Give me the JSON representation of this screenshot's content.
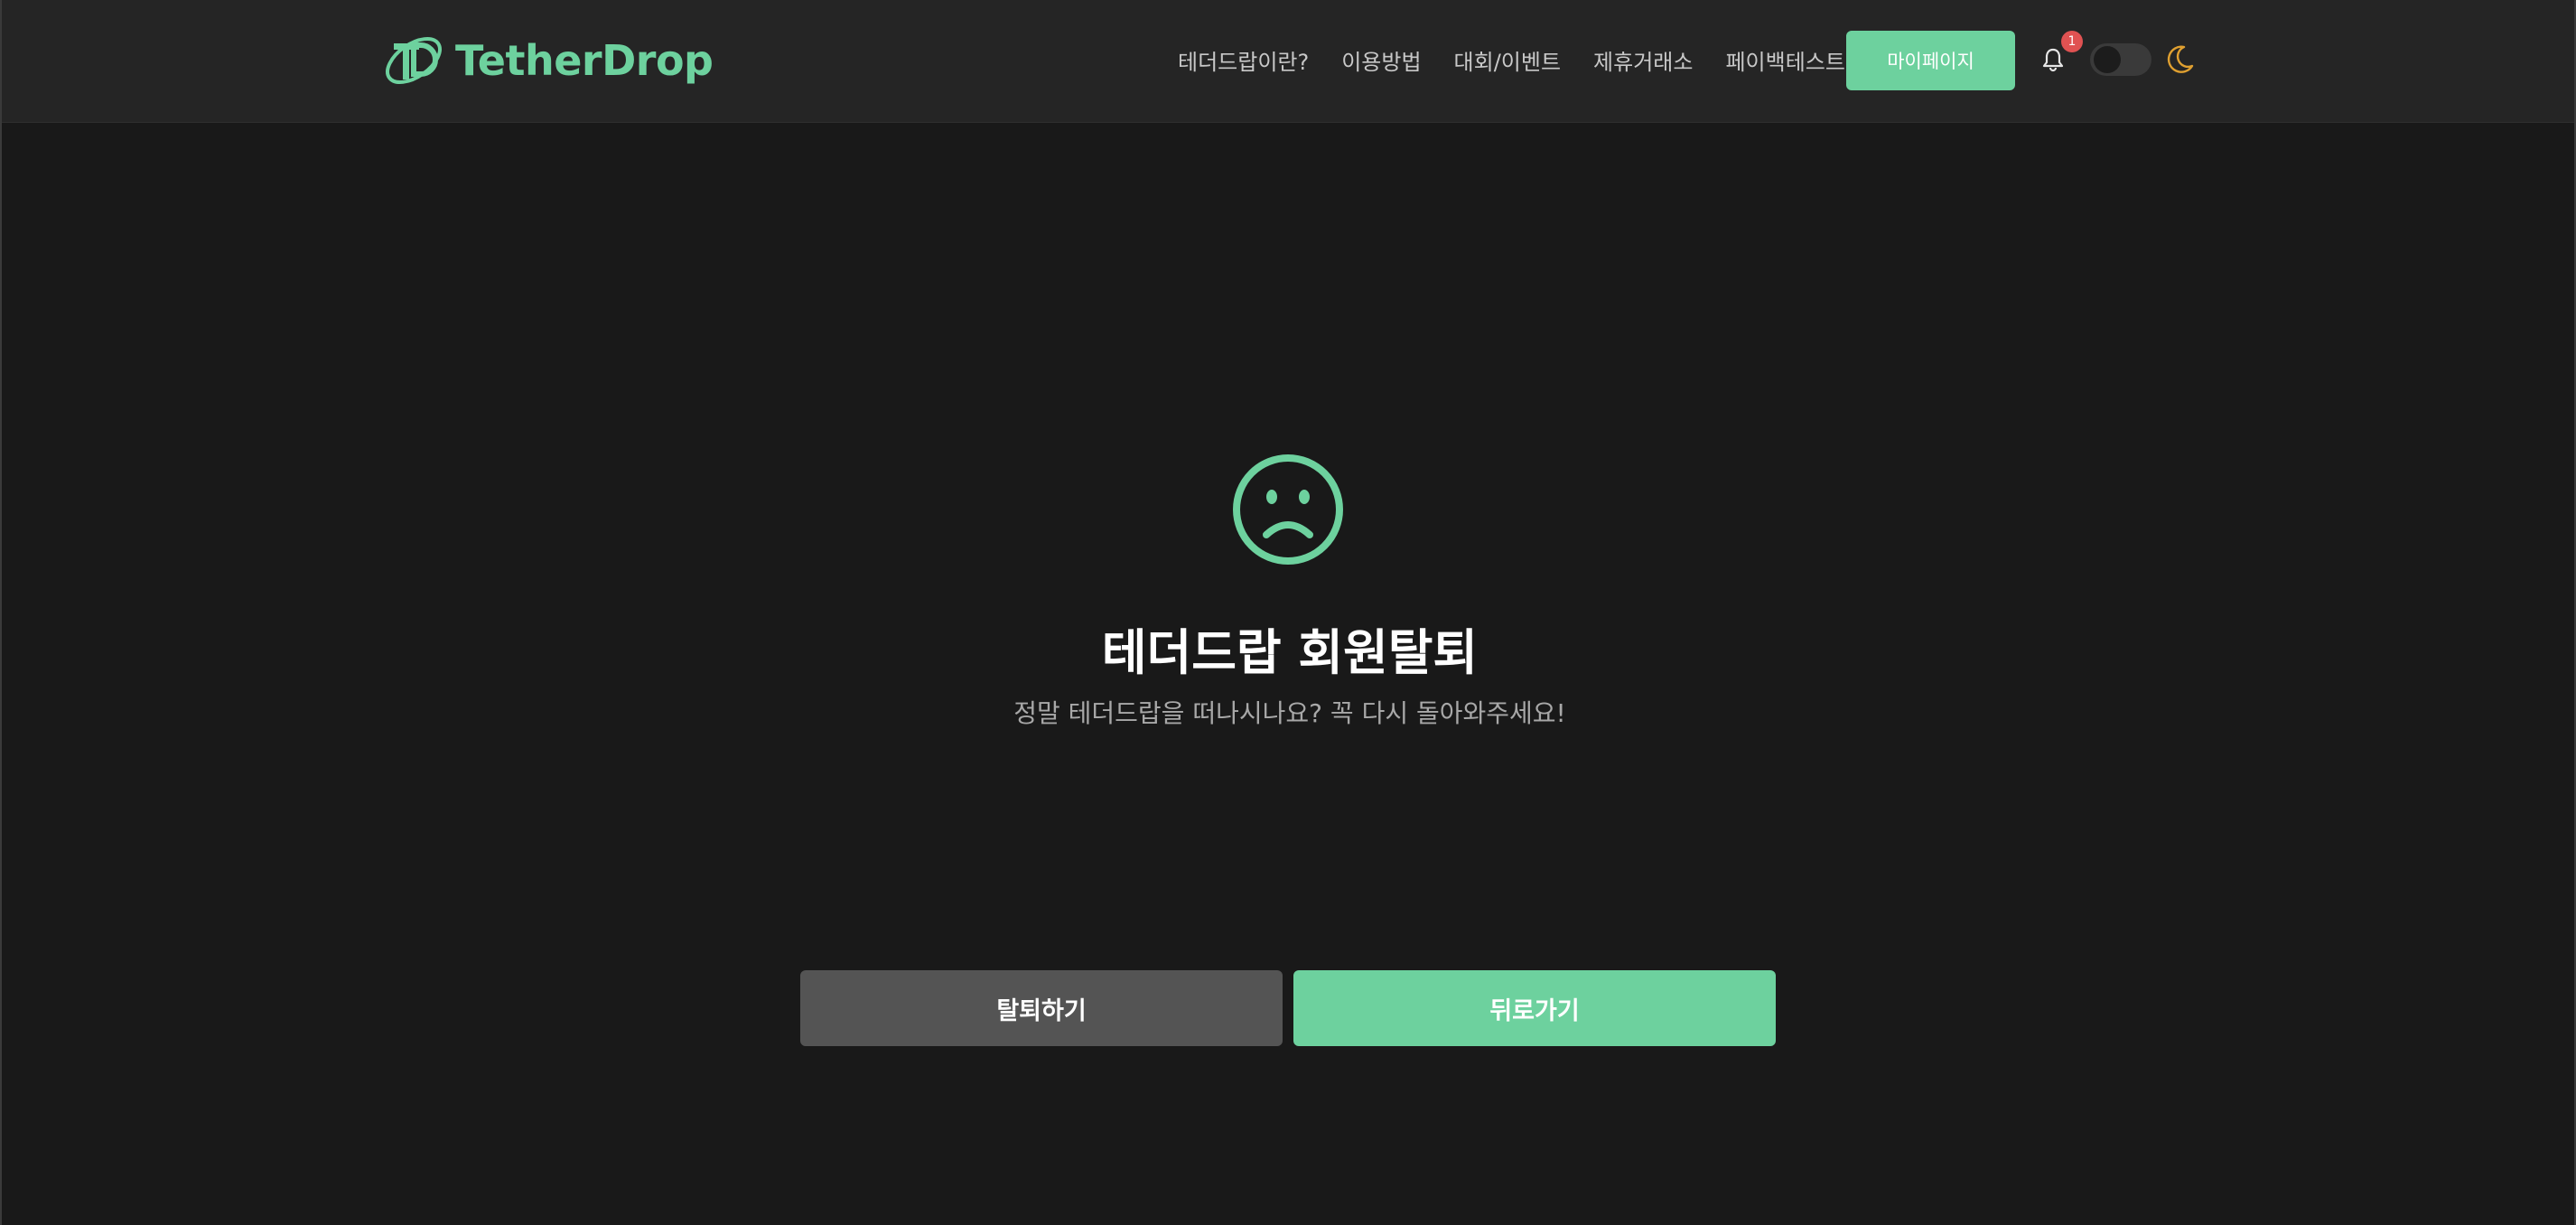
{
  "brand": {
    "name": "TetherDrop",
    "accent": "#6dd19e"
  },
  "nav": {
    "items": [
      {
        "label": "테더드랍이란?"
      },
      {
        "label": "이용방법"
      },
      {
        "label": "대회/이벤트"
      },
      {
        "label": "제휴거래소"
      },
      {
        "label": "페이백테스트"
      }
    ],
    "mypage_label": "마이페이지",
    "notification_count": "1",
    "dark_mode": false
  },
  "main": {
    "icon": "sad-face-icon",
    "title": "테더드랍 회원탈퇴",
    "subtitle": "정말 테더드랍을 떠나시나요? 꼭 다시 돌아와주세요!",
    "withdraw_label": "탈퇴하기",
    "back_label": "뒤로가기"
  },
  "colors": {
    "background": "#191919",
    "header": "#252525",
    "muted_button": "#545454",
    "badge": "#e05252",
    "moon": "#e0a030"
  }
}
